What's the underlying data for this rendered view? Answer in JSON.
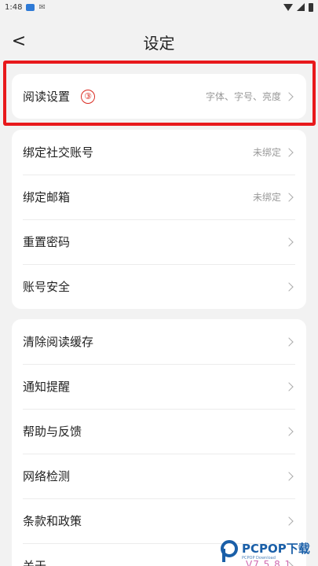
{
  "status_bar": {
    "time": "1:48"
  },
  "header": {
    "back_label": "<",
    "title": "设定"
  },
  "reading_card": {
    "items": [
      {
        "label": "阅读设置",
        "badge": "③",
        "value": "字体、字号、亮度"
      }
    ]
  },
  "account_card": {
    "items": [
      {
        "label": "绑定社交账号",
        "value": "未绑定"
      },
      {
        "label": "绑定邮箱",
        "value": "未绑定"
      },
      {
        "label": "重置密码",
        "value": ""
      },
      {
        "label": "账号安全",
        "value": ""
      }
    ]
  },
  "general_card": {
    "items": [
      {
        "label": "清除阅读缓存"
      },
      {
        "label": "通知提醒"
      },
      {
        "label": "帮助与反馈"
      },
      {
        "label": "网络检测"
      },
      {
        "label": "条款和政策"
      },
      {
        "label": "关于"
      }
    ]
  },
  "watermark": {
    "brand": "PCPOP下载",
    "sub": "PCPOP Download",
    "version": "V7.5.8.1"
  },
  "colors": {
    "highlight": "#e8191c",
    "badge": "#d9281e",
    "background": "#f2f2f2"
  }
}
